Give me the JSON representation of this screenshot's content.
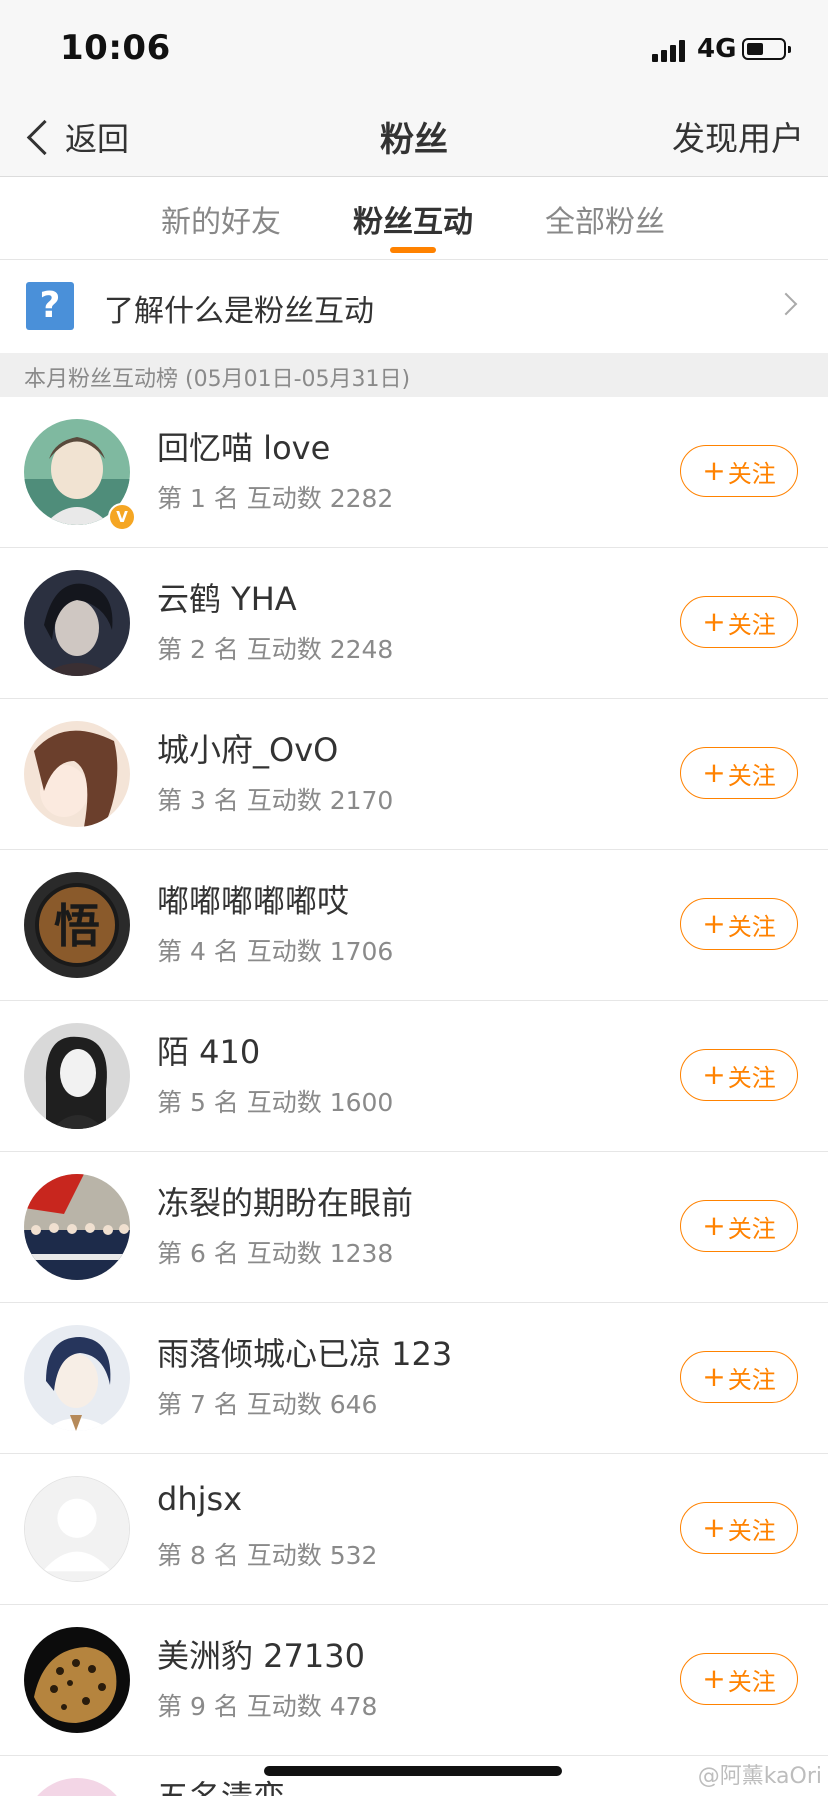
{
  "status_bar": {
    "time": "10:06",
    "network": "4G"
  },
  "nav": {
    "back_label": "返回",
    "title": "粉丝",
    "right_action": "发现用户"
  },
  "tabs": [
    {
      "label": "新的好友",
      "active": false
    },
    {
      "label": "粉丝互动",
      "active": true
    },
    {
      "label": "全部粉丝",
      "active": false
    }
  ],
  "info": {
    "text": "了解什么是粉丝互动",
    "icon": "question-icon"
  },
  "section": {
    "header": "本月粉丝互动榜 (05月01日-05月31日)"
  },
  "follow_label": "关注",
  "fans": [
    {
      "name": "回忆喵 love",
      "meta": "第 1 名 互动数 2282",
      "verified": true
    },
    {
      "name": "云鹤 YHA",
      "meta": "第 2 名 互动数 2248"
    },
    {
      "name": "城小府_OvO",
      "meta": "第 3 名 互动数 2170"
    },
    {
      "name": "嘟嘟嘟嘟嘟哎",
      "meta": "第 4 名 互动数 1706",
      "avatar_char": "悟"
    },
    {
      "name": "陌 410",
      "meta": "第 5 名 互动数 1600"
    },
    {
      "name": "冻裂的期盼在眼前",
      "meta": "第 6 名 互动数 1238"
    },
    {
      "name": "雨落倾城心已凉 123",
      "meta": "第 7 名 互动数 646"
    },
    {
      "name": "dhjsx",
      "meta": "第 8 名 互动数 532"
    },
    {
      "name": "美洲豹 27130",
      "meta": "第 9 名 互动数 478"
    }
  ],
  "partial_fan": {
    "name": "五名清栾"
  },
  "verified_mark": "V",
  "watermark": "@阿薰kaOri",
  "colors": {
    "accent": "#ff8200",
    "info_icon": "#4a90d9",
    "badge": "#f5a623"
  }
}
